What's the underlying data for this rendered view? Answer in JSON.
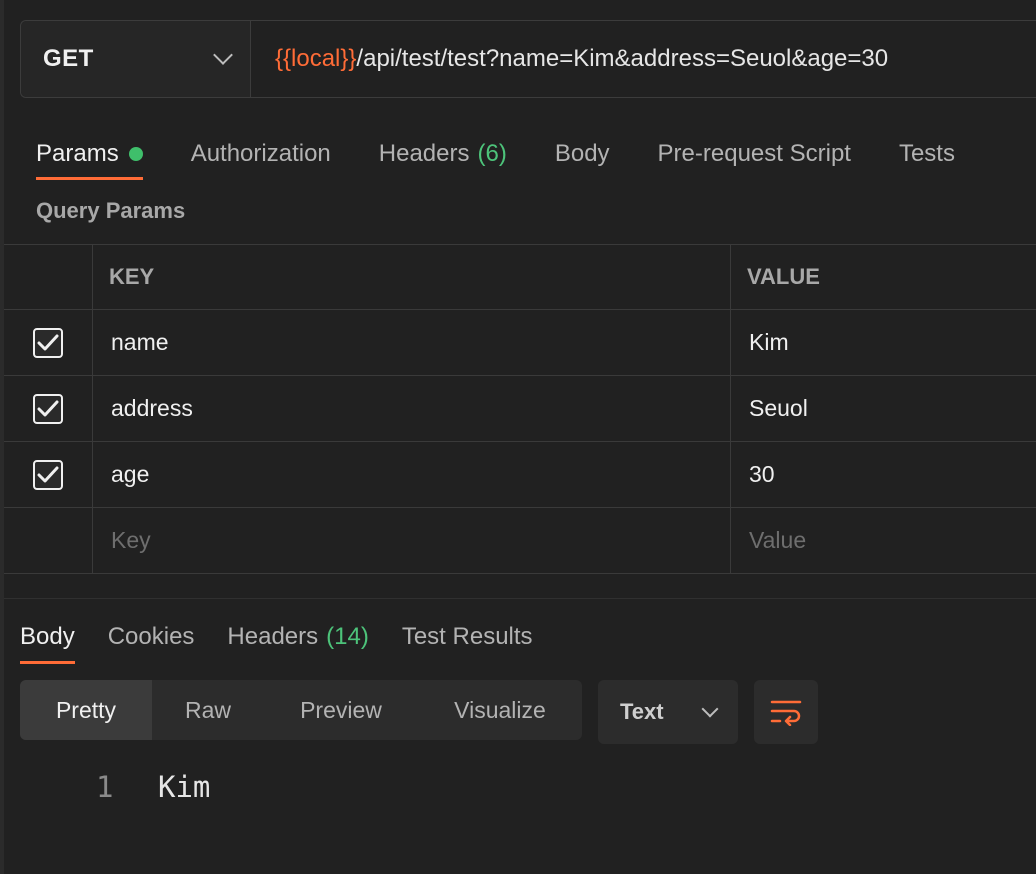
{
  "request": {
    "method": "GET",
    "url_var": "{{local}}",
    "url_rest": "/api/test/test?name=Kim&address=Seuol&age=30"
  },
  "request_tabs": [
    {
      "label": "Params",
      "active": true,
      "has_dot": true
    },
    {
      "label": "Authorization"
    },
    {
      "label": "Headers",
      "count": "(6)"
    },
    {
      "label": "Body"
    },
    {
      "label": "Pre-request Script"
    },
    {
      "label": "Tests"
    }
  ],
  "query_params": {
    "title": "Query Params",
    "headers": {
      "key": "KEY",
      "value": "VALUE"
    },
    "rows": [
      {
        "key": "name",
        "value": "Kim",
        "checked": true
      },
      {
        "key": "address",
        "value": "Seuol",
        "checked": true
      },
      {
        "key": "age",
        "value": "30",
        "checked": true
      }
    ],
    "placeholder": {
      "key": "Key",
      "value": "Value"
    }
  },
  "response_tabs": [
    {
      "label": "Body",
      "active": true
    },
    {
      "label": "Cookies"
    },
    {
      "label": "Headers",
      "count": "(14)"
    },
    {
      "label": "Test Results"
    }
  ],
  "view_modes": [
    "Pretty",
    "Raw",
    "Preview",
    "Visualize"
  ],
  "active_view_mode": "Pretty",
  "format": "Text",
  "response_body": [
    {
      "line": "1",
      "text": "Kim"
    }
  ],
  "colors": {
    "accent": "#ff6c37",
    "success": "#3fbf6b",
    "background": "#212121"
  }
}
